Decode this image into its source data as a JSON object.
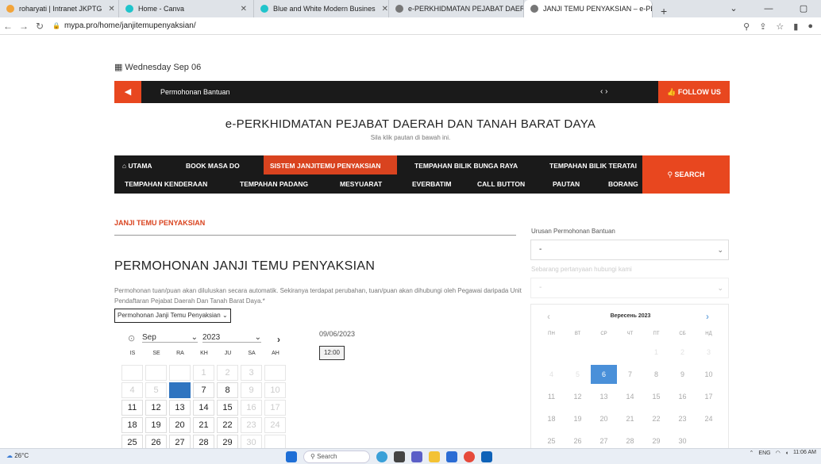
{
  "browser": {
    "tabs": [
      {
        "label": "roharyati | Intranet JKPTG",
        "color": "#f2a43a"
      },
      {
        "label": "Home - Canva",
        "color": "#20c4cb"
      },
      {
        "label": "Blue and White Modern Busines",
        "color": "#20c4cb"
      },
      {
        "label": "e-PERKHIDMATAN PEJABAT DAER",
        "color": "#555555"
      },
      {
        "label": "JANJI TEMU PENYAKSIAN – e-PE",
        "color": "#555555"
      }
    ],
    "new_tab": "+",
    "url": "mypa.pro/home/janjitemupenyaksian/"
  },
  "page": {
    "date": "Wednesday Sep 06",
    "news_ticker": "Permohonan Bantuan",
    "news_arrows": "‹ ›",
    "follow_label": "FOLLOW US",
    "site_title": "e-PERKHIDMATAN PEJABAT DAERAH DAN TANAH BARAT DAYA",
    "site_subtitle": "Sila klik pautan di bawah ini.",
    "nav": {
      "items": [
        "UTAMA",
        "BOOK MASA DO",
        "SISTEM JANJITEMU PENYAKSIAN",
        "TEMPAHAN BILIK BUNGA RAYA",
        "TEMPAHAN BILIK TERATAI",
        "TEMPAHAN KENDERAAN",
        "TEMPAHAN PADANG",
        "MESYUARAT",
        "EVERBATIM",
        "CALL BUTTON",
        "PAUTAN",
        "BORANG"
      ],
      "search_label": "SEARCH"
    },
    "section_heading": "JANJI TEMU PENYAKSIAN",
    "form_title": "PERMOHONAN JANJI TEMU PENYAKSIAN",
    "description": "Permohonan tuan/puan akan diluluskan secara automatik. Sekiranya terdapat perubahan, tuan/puan akan dihubungi oleh Pegawai daripada Unit Pendaftaran Pejabat Daerah Dan Tanah Barat Daya.*",
    "service_select": "Permohonan Janji Temu Penyaksian",
    "calendar_left": {
      "month": "Sep",
      "year": "2023",
      "weekdays": [
        "IS",
        "SE",
        "RA",
        "KH",
        "JU",
        "SA",
        "AH"
      ],
      "selected_day": "6",
      "weeks": [
        [
          "",
          "",
          "",
          "1",
          "2",
          "3",
          ""
        ],
        [
          "4",
          "5",
          "6",
          "7",
          "8",
          "9",
          "10"
        ],
        [
          "11",
          "12",
          "13",
          "14",
          "15",
          "16",
          "17"
        ],
        [
          "18",
          "19",
          "20",
          "21",
          "22",
          "23",
          "24"
        ],
        [
          "25",
          "26",
          "27",
          "28",
          "29",
          "30",
          ""
        ]
      ]
    },
    "selected_date": "09/06/2023",
    "time_slot": "12:00",
    "sidebar": {
      "label1": "Urusan Permohonan Bantuan",
      "select1_value": "-",
      "label2": "Sebarang pertanyaan hubungi kami",
      "select2_value": "-",
      "calendar": {
        "title": "Вересень 2023",
        "weekdays": [
          "ПН",
          "ВТ",
          "СР",
          "ЧТ",
          "ПТ",
          "СБ",
          "НД"
        ],
        "selected_day": "6",
        "weeks": [
          [
            "",
            "",
            "",
            "",
            "1",
            "2",
            "3"
          ],
          [
            "4",
            "5",
            "6",
            "7",
            "8",
            "9",
            "10"
          ],
          [
            "11",
            "12",
            "13",
            "14",
            "15",
            "16",
            "17"
          ],
          [
            "18",
            "19",
            "20",
            "21",
            "22",
            "23",
            "24"
          ],
          [
            "25",
            "26",
            "27",
            "28",
            "29",
            "30",
            ""
          ]
        ]
      }
    }
  },
  "taskbar": {
    "weather": "26°C",
    "search": "Search",
    "lang": "ENG",
    "time": "11:06 AM"
  }
}
